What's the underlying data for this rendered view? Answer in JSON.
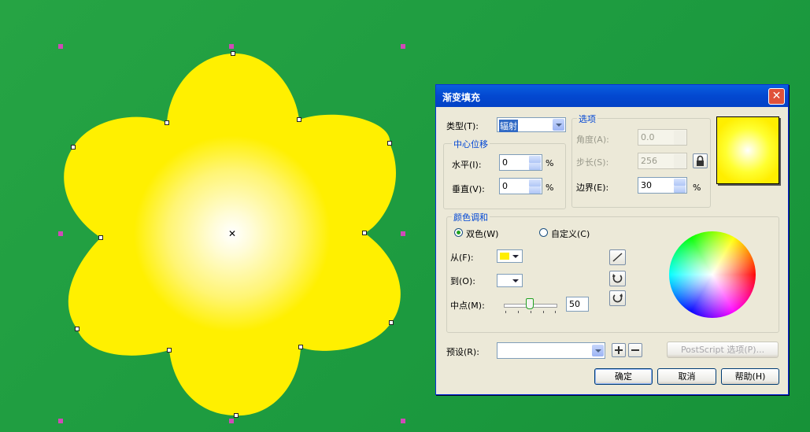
{
  "dialog": {
    "title": "渐变填充",
    "close_glyph": "✕",
    "type_label": "类型(T):",
    "type_value": "辐射",
    "center_group": "中心位移",
    "horizontal_label": "水平(I):",
    "horizontal_value": "0",
    "vertical_label": "垂直(V):",
    "vertical_value": "0",
    "percent": "%",
    "options_group": "选项",
    "angle_label": "角度(A):",
    "angle_value": "0.0",
    "steps_label": "步长(S):",
    "steps_value": "256",
    "edge_label": "边界(E):",
    "edge_value": "30",
    "blend_group": "颜色调和",
    "two_color_label": "双色(W)",
    "custom_label": "自定义(C)",
    "from_label": "从(F):",
    "to_label": "到(O):",
    "midpoint_label": "中点(M):",
    "midpoint_value": "50",
    "preset_label": "预设(R):",
    "postscript_label": "PostScript 选项(P)...",
    "ok_label": "确定",
    "cancel_label": "取消",
    "help_label": "帮助(H)",
    "from_color": "#ffee00",
    "to_color": "#ffffff",
    "selected_blend": "two-color",
    "midpoint_fraction": 0.5
  },
  "canvas": {
    "fill_outer_color": "#ffee00",
    "fill_center_color": "#ffffff",
    "background_color": "#1f9a3d",
    "handle_color": "#d04ab8"
  }
}
